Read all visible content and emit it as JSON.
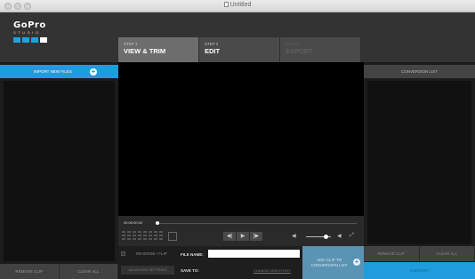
{
  "window": {
    "title": "Untitled"
  },
  "logo": {
    "word": "GoPro",
    "sub": "STUDIO"
  },
  "steps": [
    {
      "number": "Step 1",
      "name": "VIEW & TRIM"
    },
    {
      "number": "Step 2",
      "name": "EDIT"
    },
    {
      "number": "Step 3",
      "name": "EXPORT"
    }
  ],
  "left_panel": {
    "import_label": "IMPORT NEW FILES",
    "remove_label": "REMOVE CLIP",
    "clear_label": "CLEAR ALL"
  },
  "player": {
    "timecode": "00:00:00:00",
    "rewind_icon": "◀|",
    "play_icon": "▶",
    "forward_icon": "|▶",
    "volume_icon": "◀",
    "fullscreen_icon": "⤢"
  },
  "export": {
    "reverse_label": "REVERSE / FLIP",
    "advanced_label": "ADVANCED SETTINGS",
    "filename_label": "FILE NAME:",
    "filename_value": "",
    "saveto_label": "SAVE TO:",
    "saveto_value": "",
    "change_label": "CHANGE DIRECTORY",
    "add_line1": "ADD CLIP TO",
    "add_line2": "CONVERSION LIST"
  },
  "right_panel": {
    "header": "CONVERSION LIST",
    "remove_label": "REMOVE CLIP",
    "clear_label": "CLEAR ALL",
    "convert_label": "CONVERT"
  },
  "colors": {
    "accent": "#1e9cdb",
    "add_button": "#5a93b3"
  }
}
